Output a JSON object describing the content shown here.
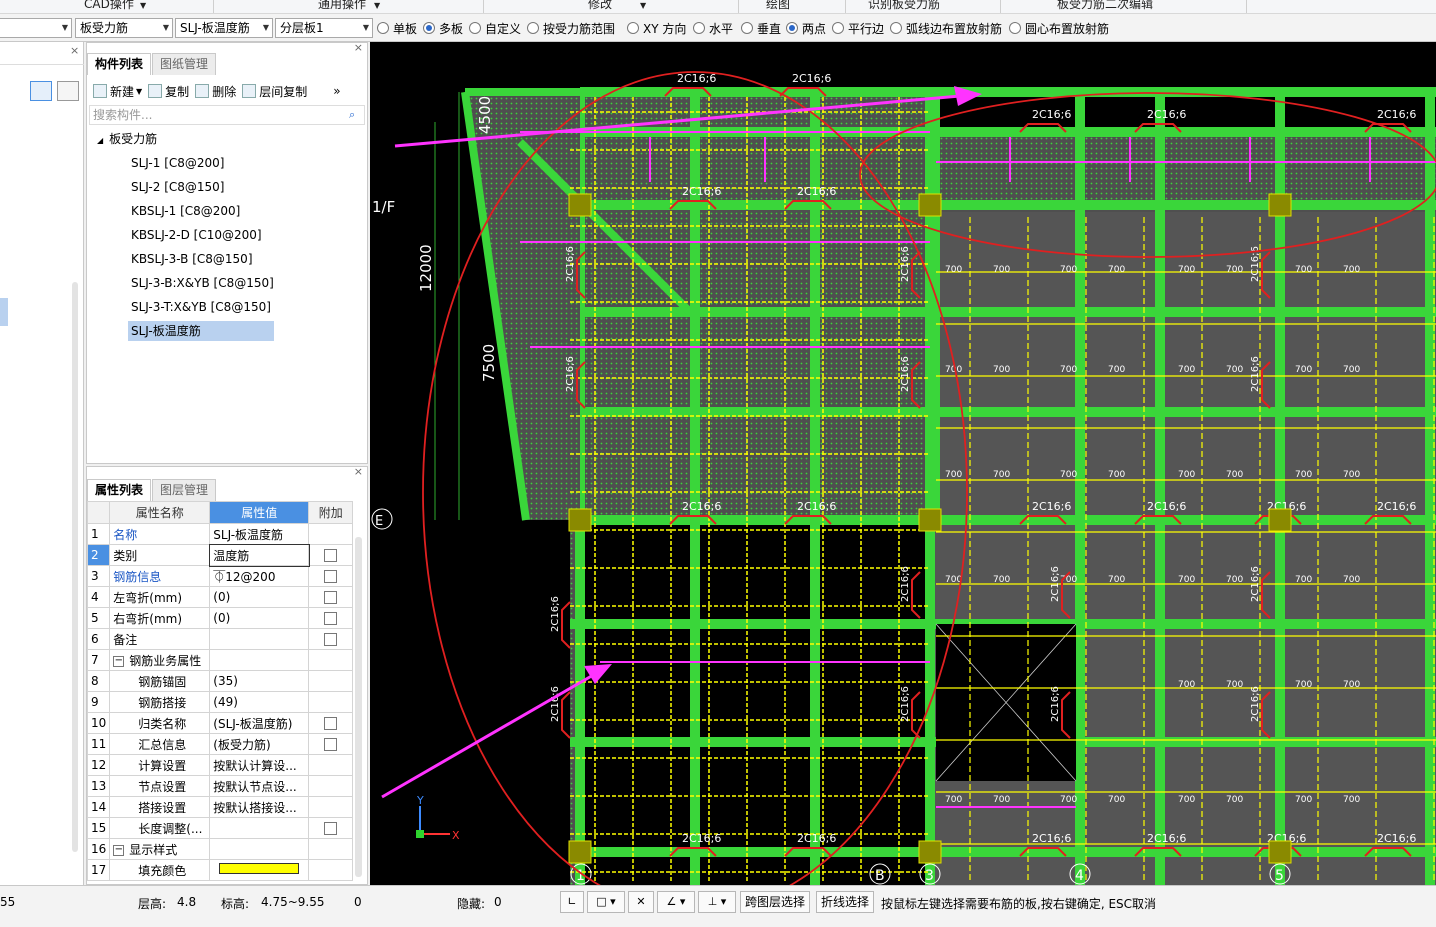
{
  "ribbon": {
    "groups": [
      "CAD操作",
      "通用操作",
      "修改",
      "绘图",
      "识别板受力筋",
      "板受力筋二次编辑"
    ]
  },
  "optionbar": {
    "combo1": "板受力筋",
    "combo2": "SLJ-板温度筋",
    "combo3": "分层板1",
    "radios": [
      {
        "label": "单板",
        "checked": false
      },
      {
        "label": "多板",
        "checked": true
      },
      {
        "label": "自定义",
        "checked": false
      },
      {
        "label": "按受力筋范围",
        "checked": false
      },
      {
        "label": "XY 方向",
        "checked": false
      },
      {
        "label": "水平",
        "checked": false
      },
      {
        "label": "垂直",
        "checked": false
      },
      {
        "label": "两点",
        "checked": true
      },
      {
        "label": "平行边",
        "checked": false
      },
      {
        "label": "弧线边布置放射筋",
        "checked": false
      },
      {
        "label": "圆心布置放射筋",
        "checked": false
      }
    ]
  },
  "component_panel": {
    "tabs": [
      "构件列表",
      "图纸管理"
    ],
    "toolbar": {
      "new": "新建",
      "copy": "复制",
      "delete": "删除",
      "floor_copy": "层间复制"
    },
    "search_placeholder": "搜索构件...",
    "tree_root": "板受力筋",
    "items": [
      "SLJ-1 [C8@200]",
      "SLJ-2 [C8@150]",
      "KBSLJ-1 [C8@200]",
      "KBSLJ-2-D [C10@200]",
      "KBSLJ-3-B [C8@150]",
      "SLJ-3-B:X&YB [C8@150]",
      "SLJ-3-T:X&YB [C8@150]",
      "SLJ-板温度筋"
    ],
    "selected_index": 7
  },
  "property_panel": {
    "tabs": [
      "属性列表",
      "图层管理"
    ],
    "headers": {
      "name": "属性名称",
      "value": "属性值",
      "extra": "附加"
    },
    "rows": [
      {
        "no": "1",
        "name": "名称",
        "value": "SLJ-板温度筋",
        "check": false,
        "blue": true
      },
      {
        "no": "2",
        "name": "类别",
        "value": "温度筋",
        "check": true,
        "blue": false
      },
      {
        "no": "3",
        "name": "钢筋信息",
        "value": "⏁12@200",
        "check": true,
        "blue": true
      },
      {
        "no": "4",
        "name": "左弯折(mm)",
        "value": "(0)",
        "check": true,
        "blue": false
      },
      {
        "no": "5",
        "name": "右弯折(mm)",
        "value": "(0)",
        "check": true,
        "blue": false
      },
      {
        "no": "6",
        "name": "备注",
        "value": "",
        "check": true,
        "blue": false
      },
      {
        "no": "7",
        "name": "钢筋业务属性",
        "value": "",
        "check": false,
        "blue": false,
        "group": true
      },
      {
        "no": "8",
        "name": "钢筋锚固",
        "value": "(35)",
        "check": false,
        "blue": false,
        "indent": true
      },
      {
        "no": "9",
        "name": "钢筋搭接",
        "value": "(49)",
        "check": false,
        "blue": false,
        "indent": true
      },
      {
        "no": "10",
        "name": "归类名称",
        "value": "(SLJ-板温度筋)",
        "check": true,
        "blue": false,
        "indent": true
      },
      {
        "no": "11",
        "name": "汇总信息",
        "value": "(板受力筋)",
        "check": true,
        "blue": false,
        "indent": true
      },
      {
        "no": "12",
        "name": "计算设置",
        "value": "按默认计算设...",
        "check": false,
        "blue": false,
        "indent": true
      },
      {
        "no": "13",
        "name": "节点设置",
        "value": "按默认节点设...",
        "check": false,
        "blue": false,
        "indent": true
      },
      {
        "no": "14",
        "name": "搭接设置",
        "value": "按默认搭接设...",
        "check": false,
        "blue": false,
        "indent": true
      },
      {
        "no": "15",
        "name": "长度调整(...",
        "value": "",
        "check": true,
        "blue": false,
        "indent": true
      },
      {
        "no": "16",
        "name": "显示样式",
        "value": "",
        "check": false,
        "blue": false,
        "group": true
      },
      {
        "no": "17",
        "name": "填充颜色",
        "value": "",
        "check": false,
        "blue": false,
        "indent": true,
        "swatch": "#ffff00"
      }
    ]
  },
  "canvas": {
    "dims": {
      "top": "4500",
      "mid": "12000",
      "left": "7500"
    },
    "axis_labels": [
      "1/F",
      "E",
      "1",
      "B",
      "3",
      "4",
      "5"
    ],
    "rebar_label": "2C16;6",
    "small_label": "700",
    "ucs": {
      "x": "X",
      "y": "Y"
    },
    "colors": {
      "green": "#3ad63a",
      "yellow": "#ffff00",
      "magenta": "#ff33ff",
      "red": "#e02020",
      "gray": "#555555"
    }
  },
  "statusbar": {
    "left_value": "55",
    "floor_height_label": "层高:",
    "floor_height": "4.8",
    "elevation_label": "标高:",
    "elevation": "4.75~9.55",
    "zero": "0",
    "hidden_label": "隐藏:",
    "hidden_count": "0",
    "btn_cross_floor": "跨图层选择",
    "btn_polyline": "折线选择",
    "hint": "按鼠标左键选择需要布筋的板,按右键确定, ESC取消"
  }
}
